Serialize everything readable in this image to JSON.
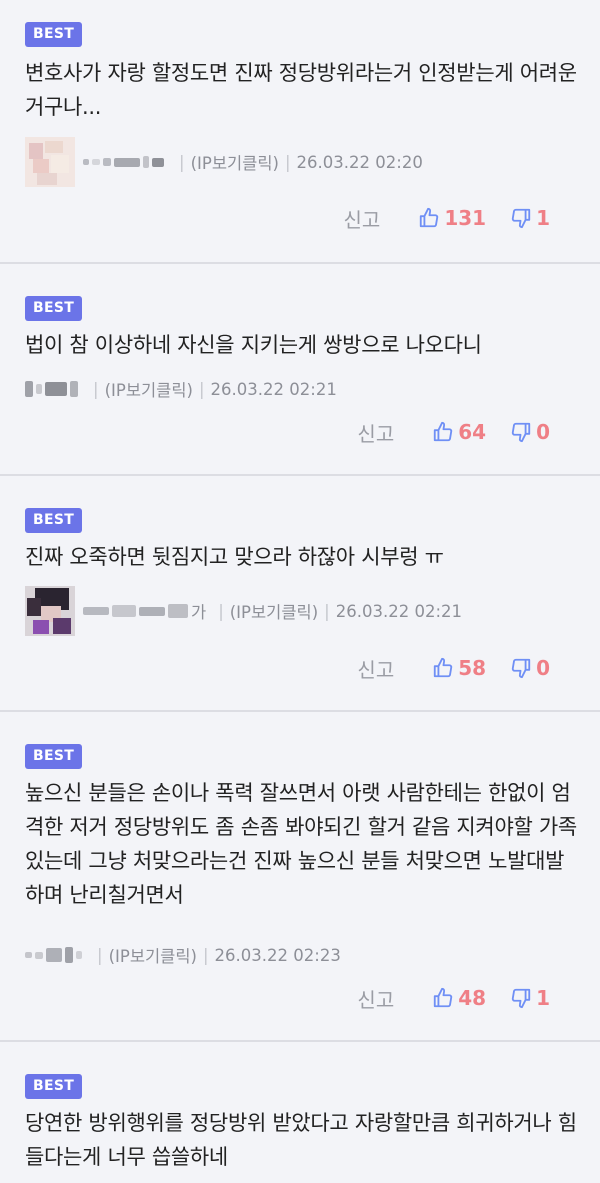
{
  "labels": {
    "report": "신고",
    "ip_label": "(IP보기클릭)"
  },
  "colors": {
    "badge": "#6b74e8",
    "vote_count": "#ef7f86",
    "thumb_icon": "#6f8ff5",
    "background": "#f3f4f8"
  },
  "comments": [
    {
      "badge": "BEST",
      "text": "변호사가 자랑 할정도면 진짜 정당방위라는거 인정받는게 어려운거구나...",
      "nickname_suffix": "",
      "date": "26.03.22 02:20",
      "upvotes": "131",
      "downvotes": "1",
      "avatar_icon": "blurred-avatar-icon"
    },
    {
      "badge": "BEST",
      "text": "법이 참 이상하네 자신을 지키는게 쌍방으로 나오다니",
      "nickname_suffix": "",
      "date": "26.03.22 02:21",
      "upvotes": "64",
      "downvotes": "0"
    },
    {
      "badge": "BEST",
      "text": "진짜 오죽하면 뒷짐지고 맞으라 하잖아 시부렁 ㅠ",
      "nickname_suffix": "가",
      "date": "26.03.22 02:21",
      "upvotes": "58",
      "downvotes": "0",
      "avatar_icon": "blurred-avatar-icon"
    },
    {
      "badge": "BEST",
      "text": "높으신 분들은 손이나 폭력 잘쓰면서 아랫 사람한테는 한없이 엄격한 저거 정당방위도 좀 손좀 봐야되긴 할거 같음 지켜야할 가족있는데 그냥 처맞으라는건 진짜 높으신 분들 처맞으면 노발대발하며 난리칠거면서",
      "nickname_suffix": "",
      "date": "26.03.22 02:23",
      "upvotes": "48",
      "downvotes": "1"
    },
    {
      "badge": "BEST",
      "text": "당연한 방위행위를 정당방위 받았다고 자랑할만큼 희귀하거나 힘들다는게 너무 씁쓸하네"
    }
  ]
}
